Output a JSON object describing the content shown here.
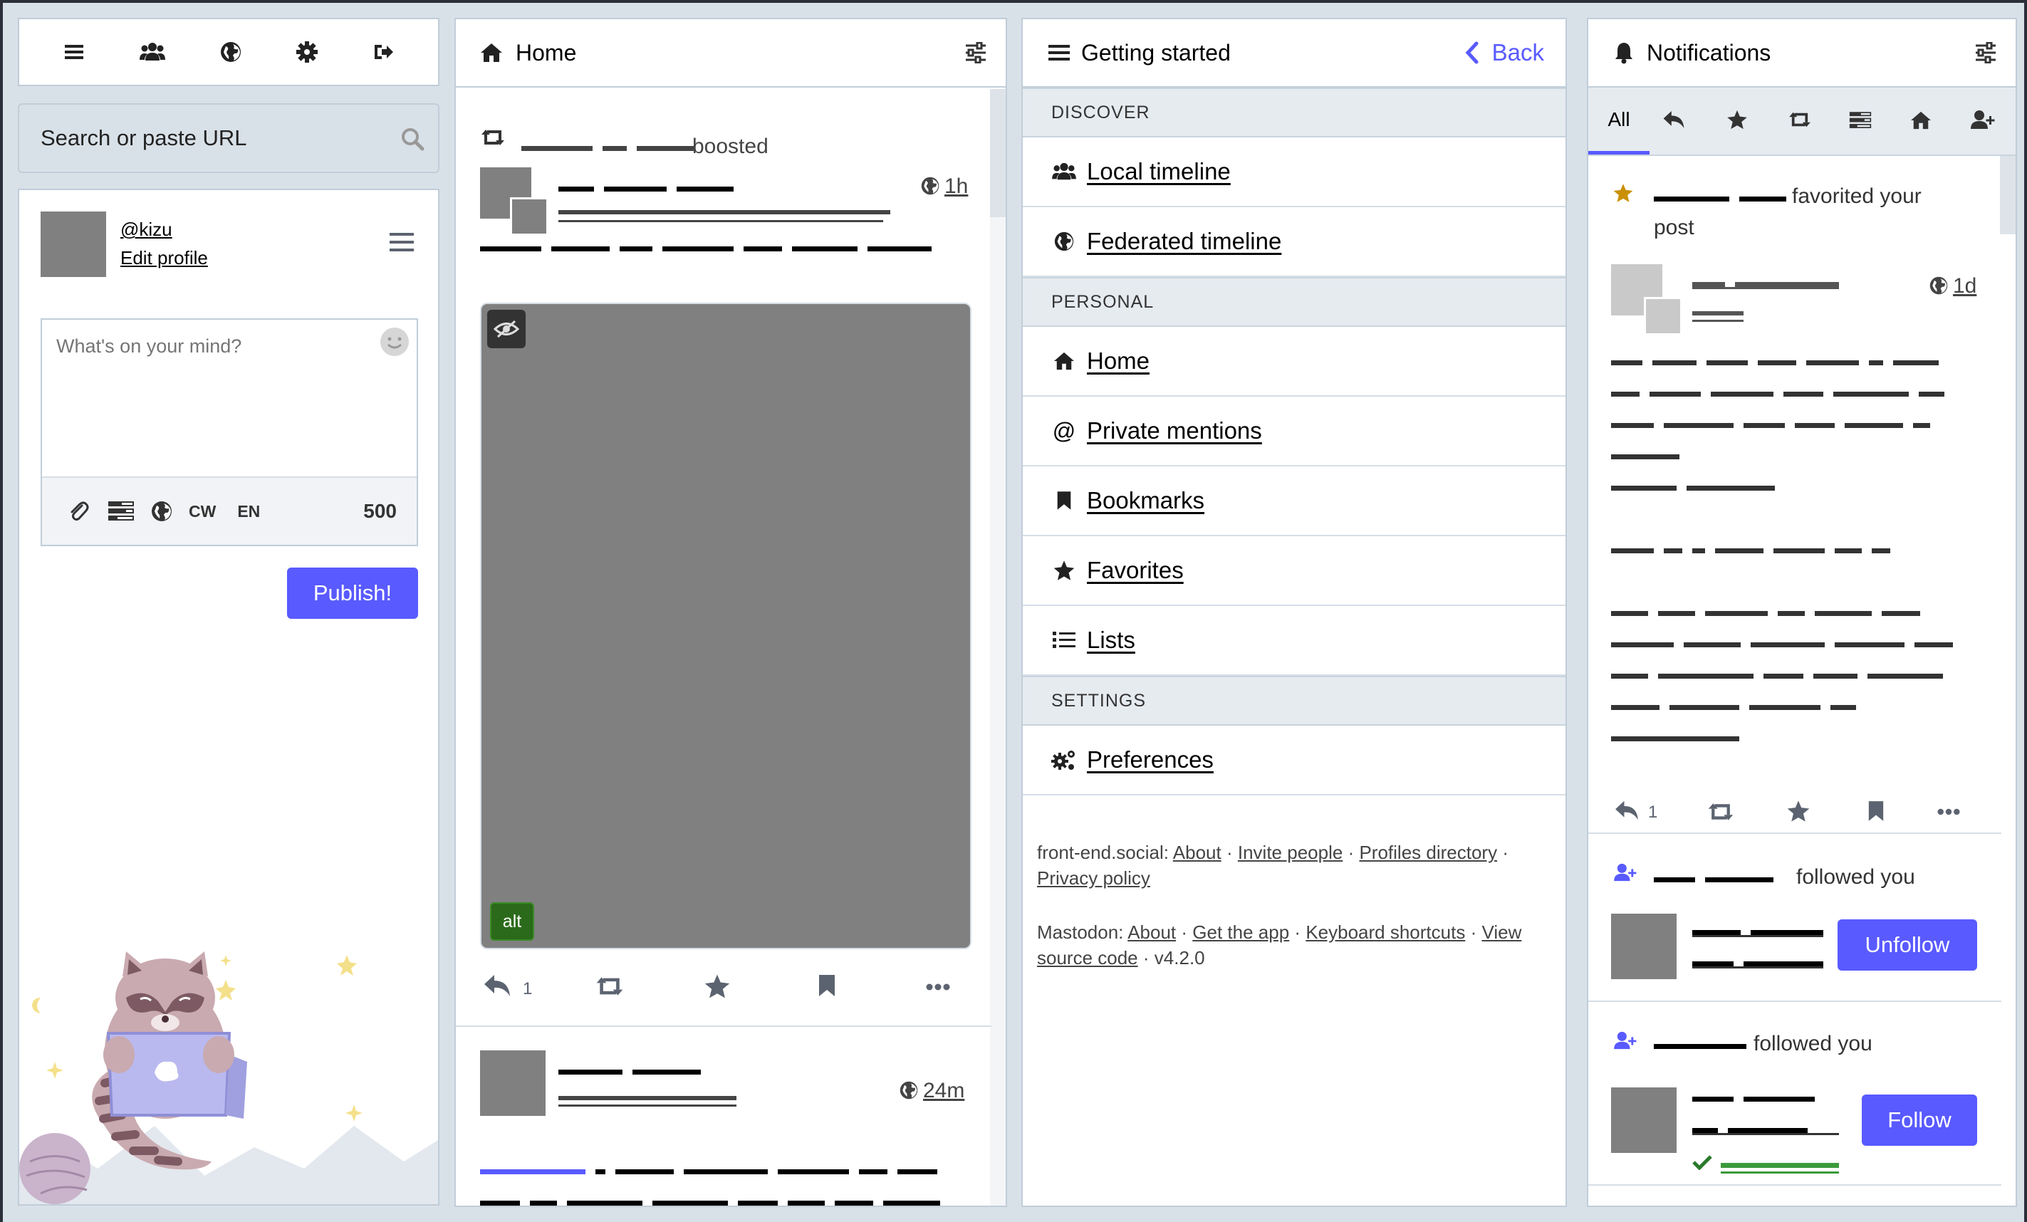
{
  "nav": {
    "icons": [
      "menu-icon",
      "people-icon",
      "globe-icon",
      "gear-icon",
      "logout-icon"
    ]
  },
  "search": {
    "placeholder": "Search or paste URL"
  },
  "profile": {
    "handle": "@kizu",
    "edit": "Edit profile"
  },
  "compose": {
    "placeholder": "What's on your mind?",
    "cw": "CW",
    "lang": "EN",
    "counter": "500",
    "publish": "Publish!"
  },
  "home": {
    "title": "Home",
    "boost_text": "boosted",
    "post1": {
      "time": "1h",
      "alt": "alt",
      "reply_count": "1"
    },
    "post2": {
      "time": "24m"
    }
  },
  "getting_started": {
    "title": "Getting started",
    "back": "Back",
    "sections": {
      "discover": "DISCOVER",
      "personal": "PERSONAL",
      "settings": "SETTINGS"
    },
    "items": {
      "local": "Local timeline",
      "federated": "Federated timeline",
      "home": "Home",
      "mentions": "Private mentions",
      "bookmarks": "Bookmarks",
      "favorites": "Favorites",
      "lists": "Lists",
      "preferences": "Preferences"
    },
    "footer": {
      "server": "front-end.social:",
      "about": "About",
      "invite": "Invite people",
      "profiles": "Profiles directory",
      "privacy": "Privacy policy",
      "mastodon": "Mastodon:",
      "about2": "About",
      "get_app": "Get the app",
      "shortcuts": "Keyboard shortcuts",
      "view": "View",
      "source": "source code",
      "version": "v4.2.0",
      "sep": "·"
    }
  },
  "notifications": {
    "title": "Notifications",
    "tab_all": "All",
    "fav": {
      "text": "favorited your",
      "text2": "post",
      "time": "1d",
      "reply_count": "1"
    },
    "follow1": {
      "text": "followed you",
      "button": "Unfollow"
    },
    "follow2": {
      "text": "followed you",
      "button": "Follow"
    }
  },
  "colors": {
    "accent": "#595aff",
    "gold": "#ca8f04",
    "green": "#2b7a2b",
    "panel": "#d9e1e8"
  }
}
